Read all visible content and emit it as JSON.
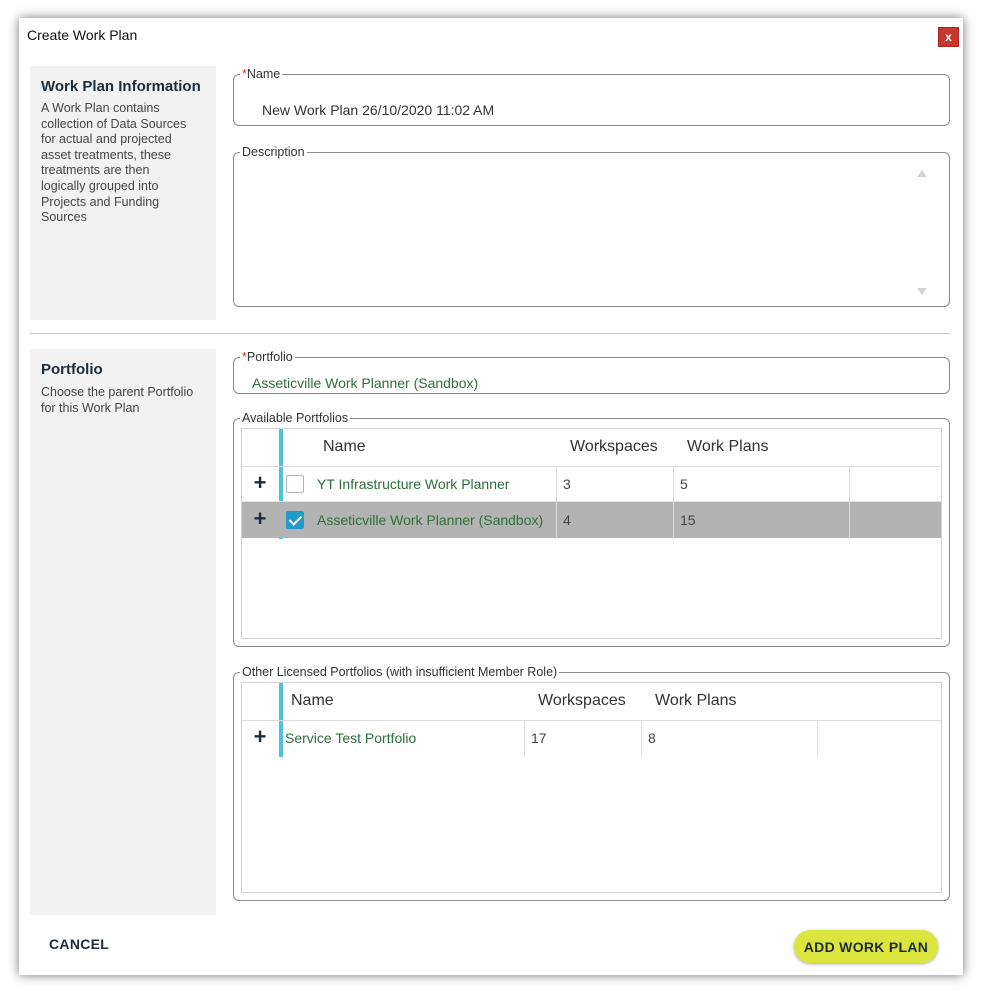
{
  "dialog": {
    "title": "Create Work Plan",
    "close_label": "x"
  },
  "info_section": {
    "heading": "Work Plan Information",
    "description_lines": [
      "A Work Plan contains",
      "collection of Data Sources",
      "for actual and projected",
      "asset treatments, these",
      "treatments are then",
      "logically grouped into",
      "Projects and Funding",
      "Sources"
    ]
  },
  "name_field": {
    "required_marker": "*",
    "label": "Name",
    "value": "New Work Plan 26/10/2020 11:02 AM"
  },
  "description_field": {
    "label": "Description",
    "value": ""
  },
  "portfolio_section": {
    "heading": "Portfolio",
    "description_lines": [
      "Choose the parent Portfolio",
      "for this Work Plan"
    ]
  },
  "portfolio_field": {
    "required_marker": "*",
    "label": "Portfolio",
    "value": "Asseticville Work Planner (Sandbox)"
  },
  "available_portfolios": {
    "label": "Available Portfolios",
    "columns": [
      "Name",
      "Workspaces",
      "Work Plans"
    ],
    "rows": [
      {
        "expand": "+",
        "checked": false,
        "name": "YT Infrastructure Work Planner",
        "workspaces": "3",
        "work_plans": "5"
      },
      {
        "expand": "+",
        "checked": true,
        "name": "Asseticville Work Planner (Sandbox)",
        "workspaces": "4",
        "work_plans": "15"
      }
    ]
  },
  "other_portfolios": {
    "label": "Other Licensed Portfolios (with insufficient Member Role)",
    "columns": [
      "Name",
      "Workspaces",
      "Work Plans"
    ],
    "rows": [
      {
        "expand": "+",
        "name": "Service Test Portfolio",
        "workspaces": "17",
        "work_plans": "8"
      }
    ]
  },
  "footer": {
    "cancel_label": "CANCEL",
    "add_label": "ADD WORK PLAN"
  },
  "colors": {
    "accent": "#4cc3de",
    "checkbox_checked": "#1e9cc8",
    "primary_button": "#dbe53d",
    "close_button": "#c8362e",
    "link_green": "#2f6e3a",
    "selected_row": "#b3b3b3"
  }
}
